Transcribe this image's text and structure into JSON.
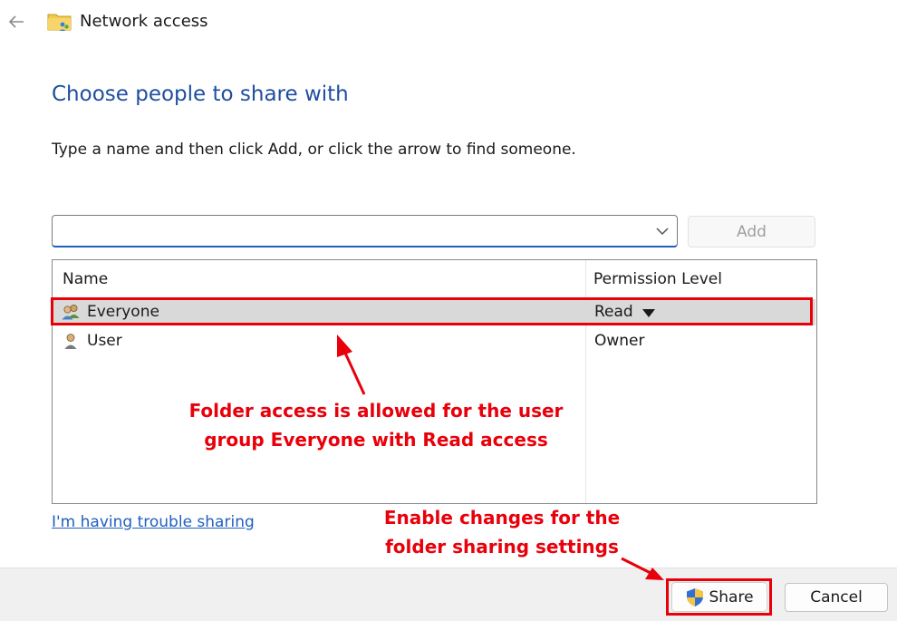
{
  "window": {
    "title": "Network access"
  },
  "main": {
    "heading": "Choose people to share with",
    "instruction": "Type a name and then click Add, or click the arrow to find someone.",
    "name_input": {
      "value": "",
      "placeholder": ""
    },
    "add_label": "Add"
  },
  "list": {
    "columns": [
      "Name",
      "Permission Level"
    ],
    "rows": [
      {
        "name": "Everyone",
        "permission": "Read",
        "selected": true,
        "icon": "users-group-icon"
      },
      {
        "name": "User",
        "permission": "Owner",
        "selected": false,
        "icon": "user-icon"
      }
    ]
  },
  "trouble_link": "I'm having trouble sharing",
  "footer": {
    "share_label": "Share",
    "cancel_label": "Cancel"
  },
  "annotations": {
    "list_note": [
      "Folder access is allowed for the user",
      "group Everyone with Read access"
    ],
    "share_note": [
      "Enable changes for the",
      "folder sharing settings"
    ]
  },
  "colors": {
    "heading": "#1f4e9e",
    "link": "#1f5fbf",
    "annotation": "#e8000b",
    "selection": "#d9d9d9"
  }
}
